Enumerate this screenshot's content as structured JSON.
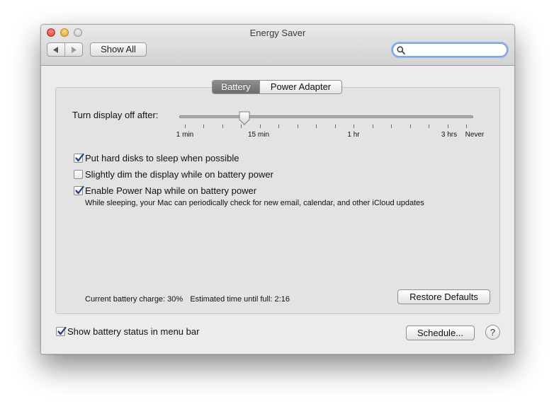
{
  "window": {
    "title": "Energy Saver"
  },
  "toolbar": {
    "back_icon": "back-arrow-icon",
    "forward_icon": "forward-arrow-icon",
    "show_all_label": "Show All",
    "search_placeholder": "",
    "search_value": ""
  },
  "tabs": [
    {
      "label": "Battery",
      "selected": true
    },
    {
      "label": "Power Adapter",
      "selected": false
    }
  ],
  "display_sleep": {
    "label": "Turn display off after:",
    "value": "15 min",
    "tick_labels": [
      "1 min",
      "15 min",
      "1 hr",
      "3 hrs",
      "Never"
    ]
  },
  "options": [
    {
      "label": "Put hard disks to sleep when possible",
      "checked": true
    },
    {
      "label": "Slightly dim the display while on battery power",
      "checked": false
    },
    {
      "label": "Enable Power Nap while on battery power",
      "checked": true,
      "description": "While sleeping, your Mac can periodically check for new email, calendar, and other iCloud updates"
    }
  ],
  "status": {
    "battery_charge": "Current battery charge: 30%",
    "time_until_full": "Estimated time until full: 2:16"
  },
  "buttons": {
    "restore_defaults": "Restore Defaults",
    "schedule": "Schedule...",
    "help": "?"
  },
  "footer": {
    "show_battery_status": {
      "label": "Show battery status in menu bar",
      "checked": true
    }
  },
  "colors": {
    "selected_tab": "#7a7a7a",
    "search_focus": "#8cb4ea",
    "checkmark": "#1f3f86"
  }
}
